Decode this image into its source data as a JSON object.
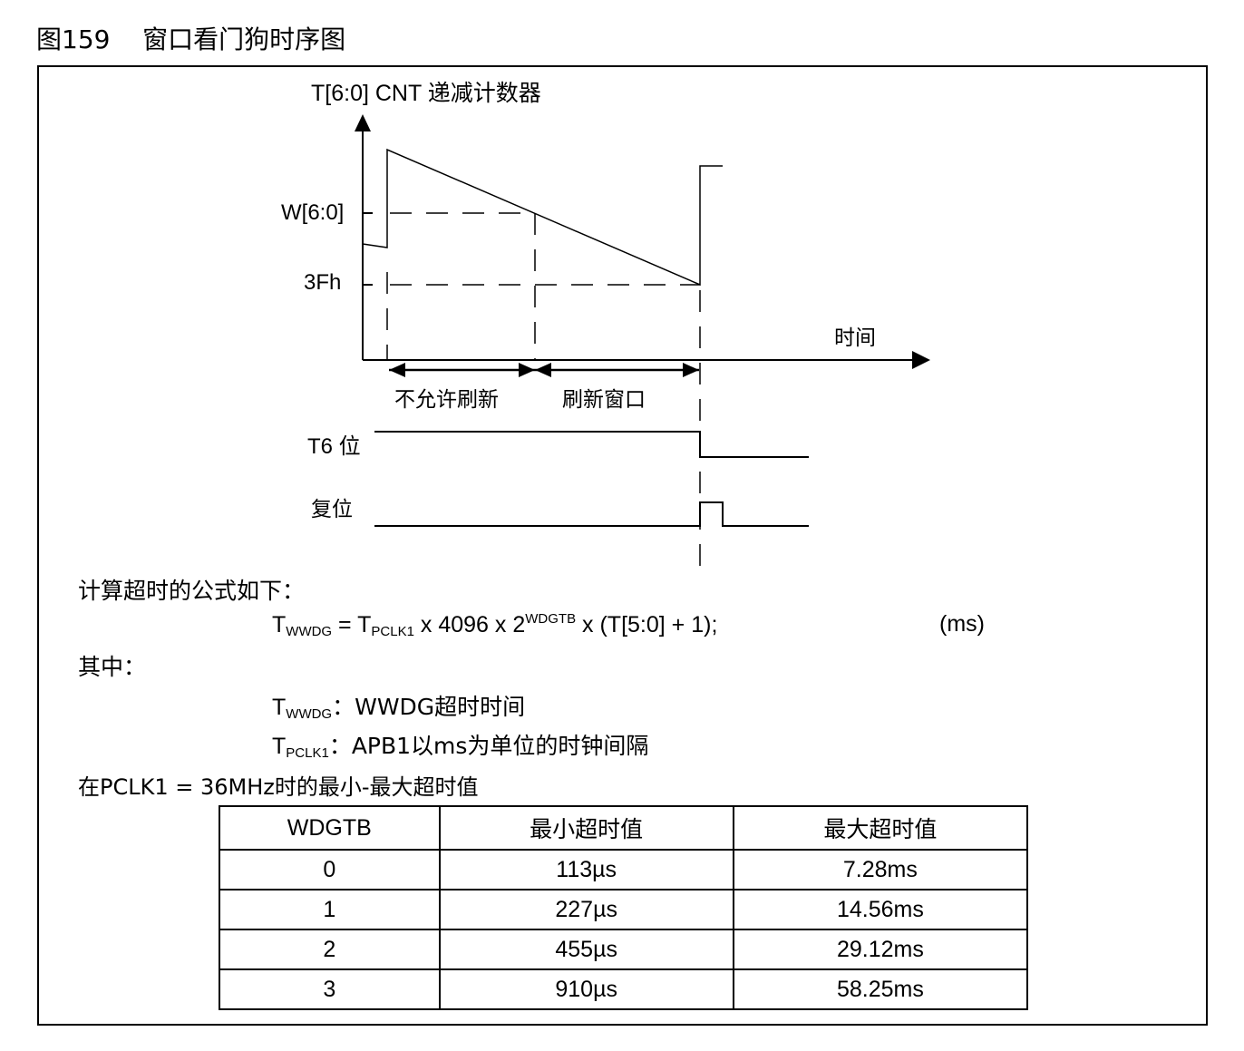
{
  "figure": {
    "number": "图159",
    "title": "窗口看门狗时序图"
  },
  "diagram": {
    "y_axis_label": "T[6:0] CNT 递减计数器",
    "w_label": "W[6:0]",
    "level_3fh_label": "3Fh",
    "x_axis_label": "时间",
    "no_refresh_label": "不允许刷新",
    "refresh_window_label": "刷新窗口",
    "t6_label": "T6 位",
    "reset_label": "复位"
  },
  "formula": {
    "intro": "计算超时的公式如下：",
    "t": "T",
    "wwdg_sub": "WWDG",
    "eq": " = T",
    "pclk_sub": "PCLK1",
    "mid": " x 4096 x 2",
    "exp": "WDGTB",
    "tail": " x (T[5:0] + 1);",
    "unit": "(ms)"
  },
  "where": {
    "label": "其中：",
    "line1_desc": "：WWDG超时时间",
    "line2_desc": "：APB1以ms为单位的时钟间隔"
  },
  "table_intro": "在PCLK1 = 36MHz时的最小-最大超时值",
  "table": {
    "headers": [
      "WDGTB",
      "最小超时值",
      "最大超时值"
    ],
    "rows": [
      [
        "0",
        "113µs",
        "7.28ms"
      ],
      [
        "1",
        "227µs",
        "14.56ms"
      ],
      [
        "2",
        "455µs",
        "29.12ms"
      ],
      [
        "3",
        "910µs",
        "58.25ms"
      ]
    ]
  }
}
